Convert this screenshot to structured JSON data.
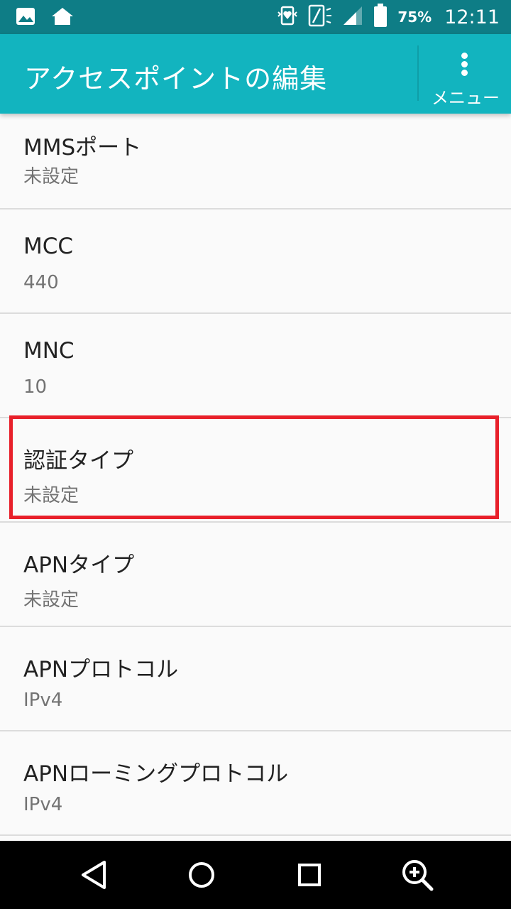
{
  "status_bar": {
    "left_icons": [
      "image-icon",
      "home-icon"
    ],
    "right_icons": [
      "vibrate-heart-icon",
      "nfc-icon",
      "signal-icon",
      "battery-icon"
    ],
    "battery_percent": "75%",
    "time": "12:11"
  },
  "app_bar": {
    "title": "アクセスポイントの編集",
    "menu_label": "メニュー"
  },
  "settings": [
    {
      "title": "MMSポート",
      "value": "未設定"
    },
    {
      "title": "MCC",
      "value": "440"
    },
    {
      "title": "MNC",
      "value": "10"
    },
    {
      "title": "認証タイプ",
      "value": "未設定"
    },
    {
      "title": "APNタイプ",
      "value": "未設定"
    },
    {
      "title": "APNプロトコル",
      "value": "IPv4"
    },
    {
      "title": "APNローミングプロトコル",
      "value": "IPv4"
    }
  ],
  "highlight_color": "#e8202a",
  "accent_color": "#12b4bf",
  "nav_bar": {
    "buttons": [
      "back-icon",
      "home-circle-icon",
      "recents-icon",
      "zoom-in-icon"
    ]
  }
}
